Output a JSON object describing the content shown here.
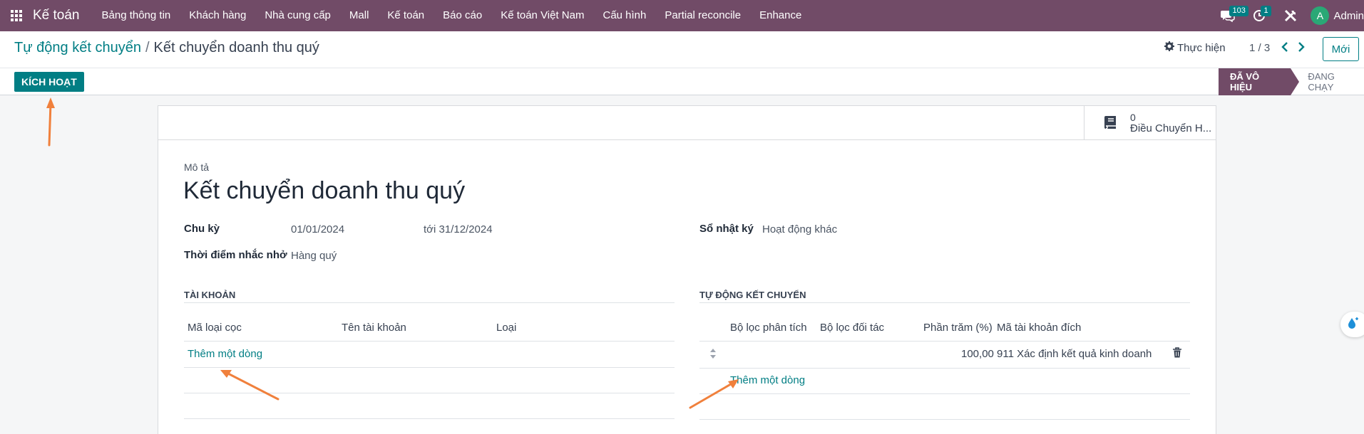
{
  "topbar": {
    "app_name": "Kế toán",
    "menu": [
      "Bảng thông tin",
      "Khách hàng",
      "Nhà cung cấp",
      "Mall",
      "Kế toán",
      "Báo cáo",
      "Kế toán Việt Nam",
      "Cấu hình",
      "Partial reconcile",
      "Enhance"
    ],
    "messages_badge": "103",
    "activities_badge": "1",
    "user_initial": "A",
    "user_name": "Admin",
    "icons": [
      "apps-icon",
      "chat-icon",
      "clock-icon",
      "tools-icon"
    ]
  },
  "control_panel": {
    "breadcrumb_parent": "Tự động kết chuyển",
    "breadcrumb_sep": "/",
    "breadcrumb_current": "Kết chuyển doanh thu quý",
    "action_label": "Thực hiện",
    "pager": "1 / 3",
    "new_label": "Mới"
  },
  "statusbar": {
    "activate_label": "KÍCH HOẠT",
    "stages": [
      "ĐÃ VÔ HIỆU",
      "ĐANG CHẠY"
    ],
    "active_stage": "ĐÃ VÔ HIỆU"
  },
  "sheet": {
    "stat_button": {
      "value": "0",
      "label": "Điều Chuyển H..."
    },
    "description_label": "Mô tả",
    "title": "Kết chuyển doanh thu quý",
    "fields": {
      "period_label": "Chu kỳ",
      "period_from": "01/01/2024",
      "period_to": "tới 31/12/2024",
      "reminder_label": "Thời điểm nhắc nhở",
      "reminder_value": "Hàng quý",
      "journal_label": "Sổ nhật ký",
      "journal_value": "Hoạt động khác"
    },
    "accounts_section": {
      "title": "TÀI KHOẢN",
      "columns": [
        "Mã loại cọc",
        "Tên tài khoản",
        "Loại"
      ],
      "add_line": "Thêm một dòng"
    },
    "auto_section": {
      "title": "TỰ ĐỘNG KẾT CHUYỂN",
      "columns": [
        "Bộ lọc phân tích",
        "Bộ lọc đối tác",
        "Phần trăm (%)",
        "Mã tài khoản đích"
      ],
      "rows": [
        {
          "percent": "100,00",
          "target": "911 Xác định kết quả kinh doanh"
        }
      ],
      "add_line": "Thêm một dòng"
    }
  },
  "colors": {
    "brand": "#714b67",
    "accent": "#017e84",
    "annotation_arrow": "#f0803c"
  }
}
